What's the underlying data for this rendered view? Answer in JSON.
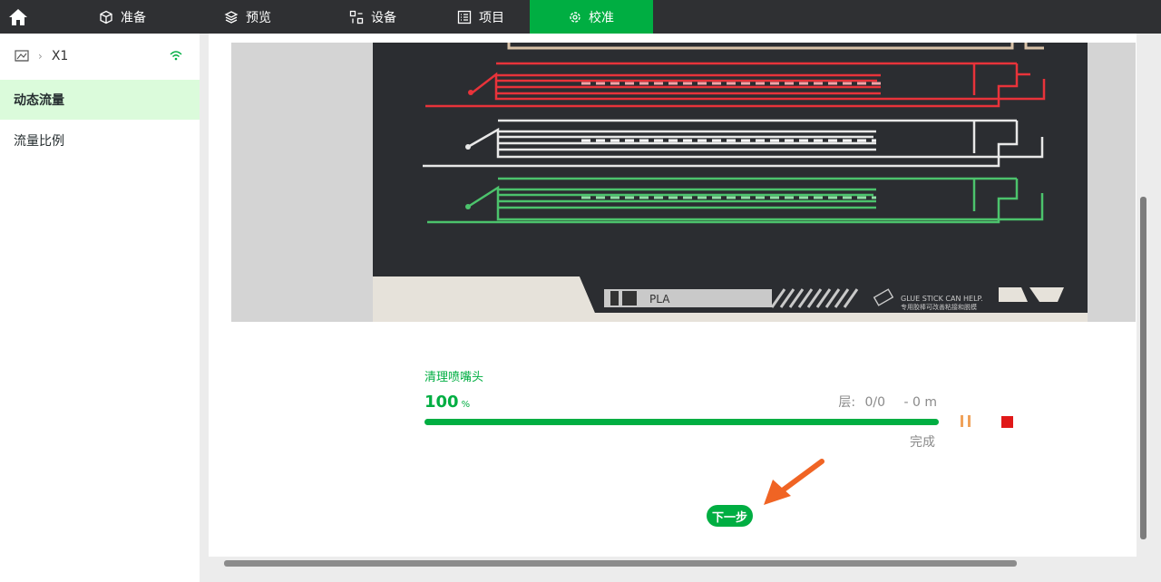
{
  "topbar": {
    "tabs": [
      {
        "label": "准备",
        "icon": "cube-icon",
        "active": false
      },
      {
        "label": "预览",
        "icon": "layers-icon",
        "active": false
      },
      {
        "label": "设备",
        "icon": "device-icon",
        "active": false
      },
      {
        "label": "项目",
        "icon": "list-icon",
        "active": false
      },
      {
        "label": "校准",
        "icon": "calibrate-icon",
        "active": true
      }
    ],
    "accent": "#00ae42"
  },
  "sidebar": {
    "device": "X1",
    "items": [
      {
        "label": "动态流量",
        "active": true
      },
      {
        "label": "流量比例",
        "active": false
      }
    ]
  },
  "main": {
    "plate_label": "PLA",
    "plate_hint_en": "GLUE STICK CAN HELP.",
    "plate_hint_cn": "专用胶棒可改善粘接和脱模",
    "status": {
      "stage": "清理喷嘴头",
      "percent": "100",
      "percent_unit": "%",
      "progress": 1.0,
      "layer_label": "层:",
      "layer_value": "0/0",
      "remaining": "- 0 m",
      "state": "完成"
    },
    "next_button": "下一步"
  }
}
